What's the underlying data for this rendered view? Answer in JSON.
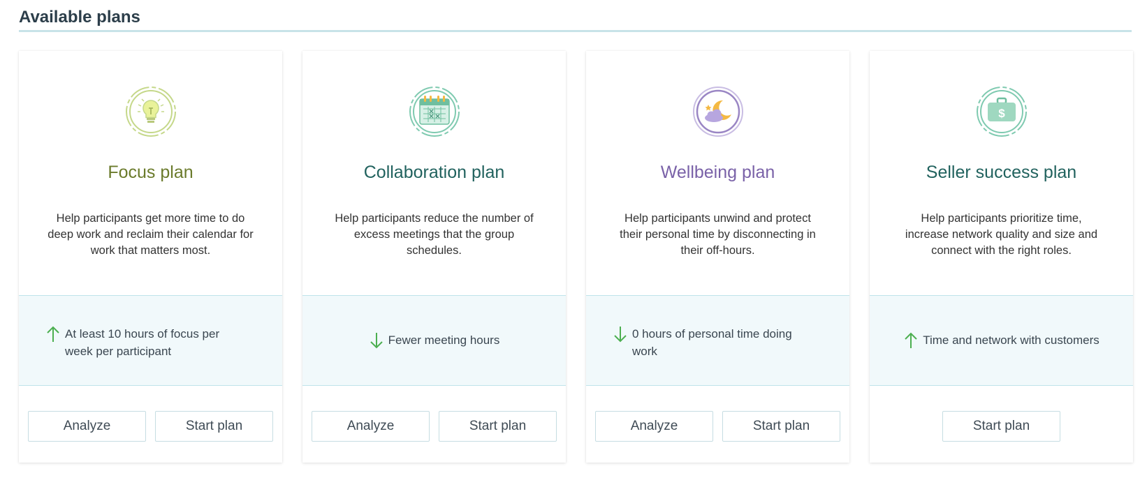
{
  "header": {
    "title": "Available plans"
  },
  "plans": [
    {
      "icon": "lightbulb-icon",
      "title": "Focus plan",
      "title_color": "#6b7b2c",
      "description": "Help participants get more time to do deep work and reclaim their calendar for work that matters most.",
      "goal_direction": "up",
      "goal_text": "At least 10 hours of focus per week per participant",
      "buttons": {
        "analyze": "Analyze",
        "start": "Start plan"
      }
    },
    {
      "icon": "calendar-icon",
      "title": "Collaboration plan",
      "title_color": "#21625e",
      "description": "Help participants reduce the number of excess meetings that the group schedules.",
      "goal_direction": "down",
      "goal_text": "Fewer meeting hours",
      "buttons": {
        "analyze": "Analyze",
        "start": "Start plan"
      }
    },
    {
      "icon": "moon-cloud-icon",
      "title": "Wellbeing plan",
      "title_color": "#7a62a8",
      "description": "Help participants unwind and protect their personal time by disconnecting in their off-hours.",
      "goal_direction": "down",
      "goal_text": "0 hours of personal time doing work",
      "buttons": {
        "analyze": "Analyze",
        "start": "Start plan"
      }
    },
    {
      "icon": "briefcase-dollar-icon",
      "title": "Seller success plan",
      "title_color": "#21625e",
      "description": "Help participants prioritize time, increase network quality and size and connect with the right roles.",
      "goal_direction": "up",
      "goal_text": "Time and network with customers",
      "buttons": {
        "start": "Start plan"
      }
    }
  ],
  "colors": {
    "arrow": "#4caf50",
    "band_bg": "#f1f9fb",
    "divider": "#c8e3e8"
  }
}
